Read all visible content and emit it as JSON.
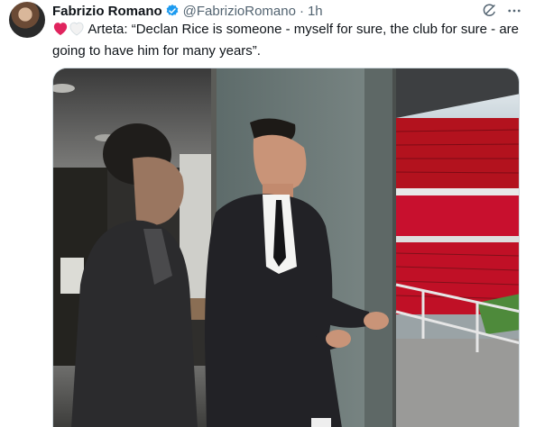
{
  "author": {
    "name": "Fabrizio Romano",
    "handle": "@FabrizioRomano",
    "separator": "·",
    "time": "1h"
  },
  "tweet": {
    "text": "Arteta: “Declan Rice is someone - myself for sure, the club for sure - are going to have him for many years”."
  },
  "icons": [
    "verified-badge-icon",
    "grok-icon",
    "more-icon",
    "red-heart-emoji",
    "white-heart-emoji"
  ],
  "colors": {
    "verified": "#1d9bf0",
    "heart_red": "#e0245e",
    "secondary_text": "#536471",
    "stadium_seat": "#c8102e"
  }
}
